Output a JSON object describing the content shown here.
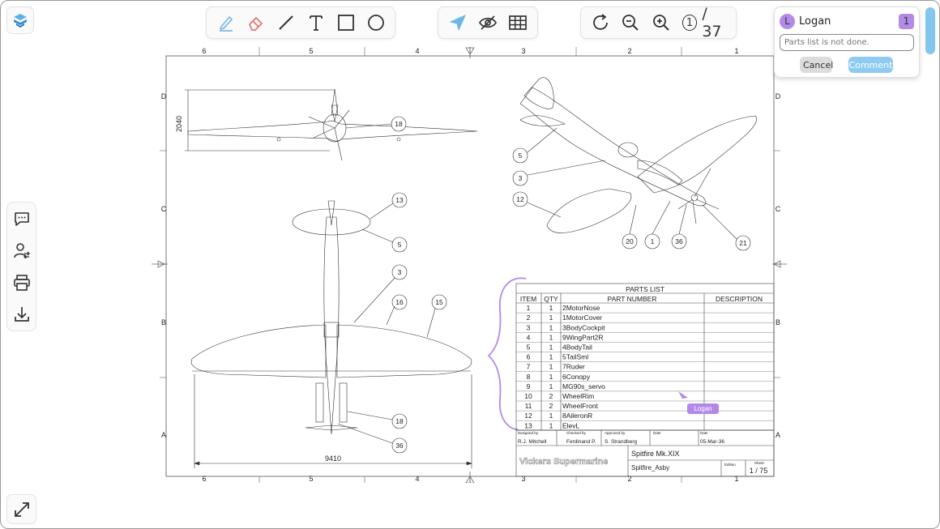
{
  "toolbar_draw": {
    "tools": [
      {
        "name": "pen-icon"
      },
      {
        "name": "eraser-icon"
      },
      {
        "name": "line-icon"
      },
      {
        "name": "text-icon"
      },
      {
        "name": "rectangle-icon"
      },
      {
        "name": "circle-icon"
      }
    ]
  },
  "toolbar_view": {
    "tools": [
      {
        "name": "pointer-icon"
      },
      {
        "name": "hide-icon"
      },
      {
        "name": "grid-icon"
      }
    ]
  },
  "toolbar_nav": {
    "current_page": "1",
    "total_pages": "/ 37"
  },
  "comment": {
    "user_initial": "L",
    "user_name": "Logan",
    "count": "1",
    "input_placeholder": "Parts list is not done.",
    "cancel_label": "Cancel",
    "comment_label": "Comment"
  },
  "drawing": {
    "col_labels": [
      "6",
      "5",
      "4",
      "3",
      "2",
      "1"
    ],
    "row_labels": [
      "D",
      "C",
      "B",
      "A"
    ],
    "dimension_height": "2040",
    "dimension_width": "9410",
    "callouts": [
      "18",
      "5",
      "3",
      "12",
      "20",
      "1",
      "36",
      "21",
      "13",
      "5",
      "3",
      "16",
      "15",
      "18",
      "36"
    ],
    "parts_list_title": "PARTS LIST",
    "parts_headers": [
      "ITEM",
      "QTY",
      "PART NUMBER",
      "DESCRIPTION"
    ],
    "parts": [
      [
        "1",
        "1",
        "2MotorNose",
        ""
      ],
      [
        "2",
        "1",
        "1MotorCover",
        ""
      ],
      [
        "3",
        "1",
        "3BodyCockpit",
        ""
      ],
      [
        "4",
        "1",
        "9WingPart2R",
        ""
      ],
      [
        "5",
        "1",
        "4BodyTail",
        ""
      ],
      [
        "6",
        "1",
        "5TailSml",
        ""
      ],
      [
        "7",
        "1",
        "7Ruder",
        ""
      ],
      [
        "8",
        "1",
        "6Conopy",
        ""
      ],
      [
        "9",
        "1",
        "MG90s_servo",
        ""
      ],
      [
        "10",
        "2",
        "WheelRim",
        ""
      ],
      [
        "11",
        "2",
        "WheelFront",
        ""
      ],
      [
        "12",
        "1",
        "8AileronR",
        ""
      ],
      [
        "13",
        "1",
        "ElevL",
        ""
      ]
    ],
    "title_block": {
      "designed_by_label": "Designed by",
      "designed_by": "R.J. Mitchell",
      "checked_by_label": "Checked by",
      "checked_by": "Ferdinand P.",
      "approved_by_label": "Approved by",
      "approved_by": "S. Strandberg",
      "date_label": "Date",
      "date_label2": "Date",
      "date": "05-Mar-36",
      "company": "Vickers Supermarine",
      "title": "Spitfire Mk.XIX",
      "subtitle": "Spitfire_Asby",
      "edition_label": "Edition",
      "sheet_label": "Sheet",
      "sheet": "1 / 75"
    },
    "annotation_author": "Logan"
  },
  "colors": {
    "accent": "#8ecbf2",
    "annotation": "#b388e9",
    "eraser": "#e57373",
    "pen": "#7bb8e6"
  }
}
